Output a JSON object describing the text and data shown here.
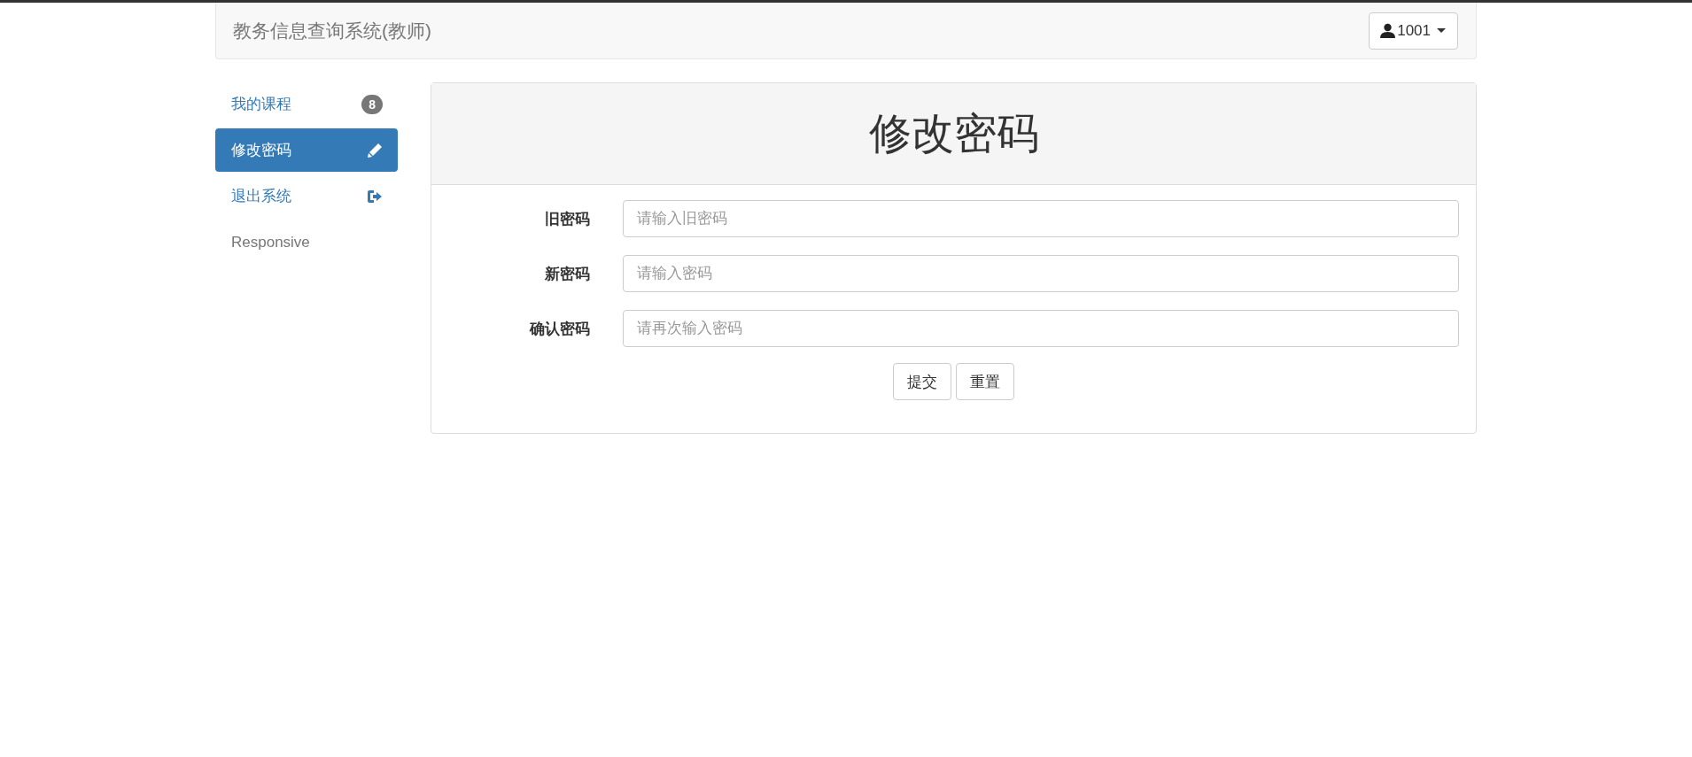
{
  "navbar": {
    "brand": "教务信息查询系统(教师)",
    "user_menu": {
      "label": "1001"
    }
  },
  "sidebar": {
    "items": [
      {
        "label": "我的课程",
        "kind": "badge",
        "badge": "8",
        "selected": false
      },
      {
        "label": "修改密码",
        "kind": "pencil",
        "selected": true
      },
      {
        "label": "退出系统",
        "kind": "logout",
        "selected": false
      },
      {
        "label": "Responsive",
        "kind": "plain",
        "selected": false
      }
    ]
  },
  "panel": {
    "title": "修改密码",
    "fields": [
      {
        "label": "旧密码",
        "placeholder": "请输入旧密码"
      },
      {
        "label": "新密码",
        "placeholder": "请输入密码"
      },
      {
        "label": "确认密码",
        "placeholder": "请再次输入密码"
      }
    ],
    "buttons": [
      "提交",
      "重置"
    ]
  }
}
